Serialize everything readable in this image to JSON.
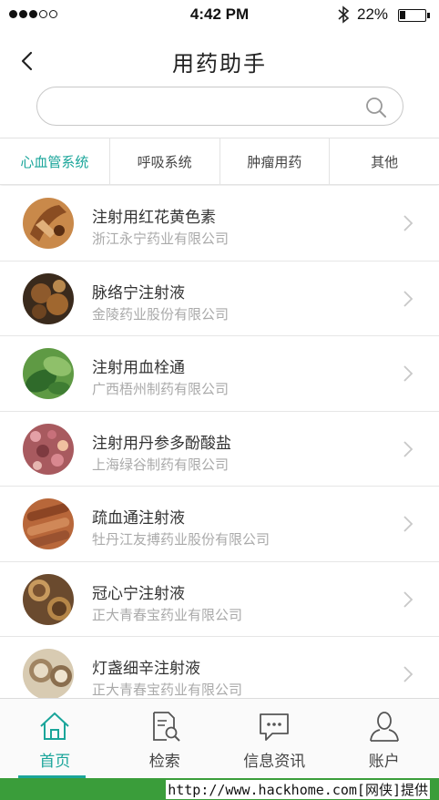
{
  "status_bar": {
    "time": "4:42 PM",
    "battery": "22%",
    "battery_level": 0.22,
    "signal_dots_filled": 3,
    "signal_dots_total": 5,
    "bluetooth_icon": "bluetooth-icon"
  },
  "header": {
    "title": "用药助手",
    "back_icon": "chevron-left-icon"
  },
  "search": {
    "value": "",
    "placeholder": "",
    "icon": "search-icon"
  },
  "tabs": [
    {
      "label": "心血管系统",
      "active": true
    },
    {
      "label": "呼吸系统",
      "active": false
    },
    {
      "label": "肿瘤用药",
      "active": false
    },
    {
      "label": "其他",
      "active": false
    }
  ],
  "drugs": [
    {
      "name": "注射用红花黄色素",
      "company": "浙江永宁药业有限公司"
    },
    {
      "name": "脉络宁注射液",
      "company": "金陵药业股份有限公司"
    },
    {
      "name": "注射用血栓通",
      "company": "广西梧州制药有限公司"
    },
    {
      "name": "注射用丹参多酚酸盐",
      "company": "上海绿谷制药有限公司"
    },
    {
      "name": "疏血通注射液",
      "company": "牡丹江友搏药业股份有限公司"
    },
    {
      "name": "冠心宁注射液",
      "company": "正大青春宝药业有限公司"
    },
    {
      "name": "灯盏细辛注射液",
      "company": "正大青春宝药业有限公司"
    }
  ],
  "tab_bar": [
    {
      "label": "首页",
      "icon": "home-icon",
      "active": true
    },
    {
      "label": "检索",
      "icon": "document-search-icon",
      "active": false
    },
    {
      "label": "信息资讯",
      "icon": "chat-bubble-icon",
      "active": false
    },
    {
      "label": "账户",
      "icon": "user-icon",
      "active": false
    }
  ],
  "watermark": "http://www.hackhome.com[网侠]提供",
  "colors": {
    "accent": "#1aa59a",
    "watermark_bar": "#3a9d3a",
    "secondary_text": "#aaaaaa"
  }
}
